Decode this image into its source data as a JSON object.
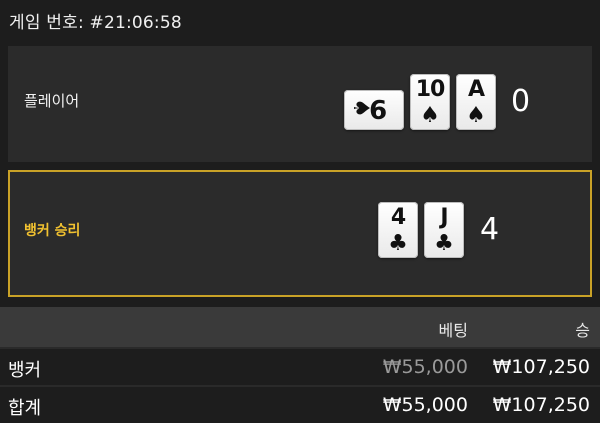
{
  "header": {
    "title": "게임 번호: #21:06:58"
  },
  "player": {
    "label": "플레이어",
    "cards": [
      {
        "rank": "9",
        "suit": "♠",
        "rotated": true
      },
      {
        "rank": "10",
        "suit": "♠"
      },
      {
        "rank": "A",
        "suit": "♠"
      }
    ],
    "score": "0"
  },
  "banker": {
    "label": "뱅커 승리",
    "cards": [
      {
        "rank": "4",
        "suit": "♣"
      },
      {
        "rank": "J",
        "suit": "♣"
      }
    ],
    "score": "4",
    "highlight_color": "#c9a227"
  },
  "table": {
    "headers": {
      "bet": "베팅",
      "win": "승"
    },
    "rows": [
      {
        "name": "뱅커",
        "bet": "₩55,000",
        "win": "₩107,250"
      },
      {
        "name": "합계",
        "bet": "₩55,000",
        "win": "₩107,250"
      }
    ]
  }
}
